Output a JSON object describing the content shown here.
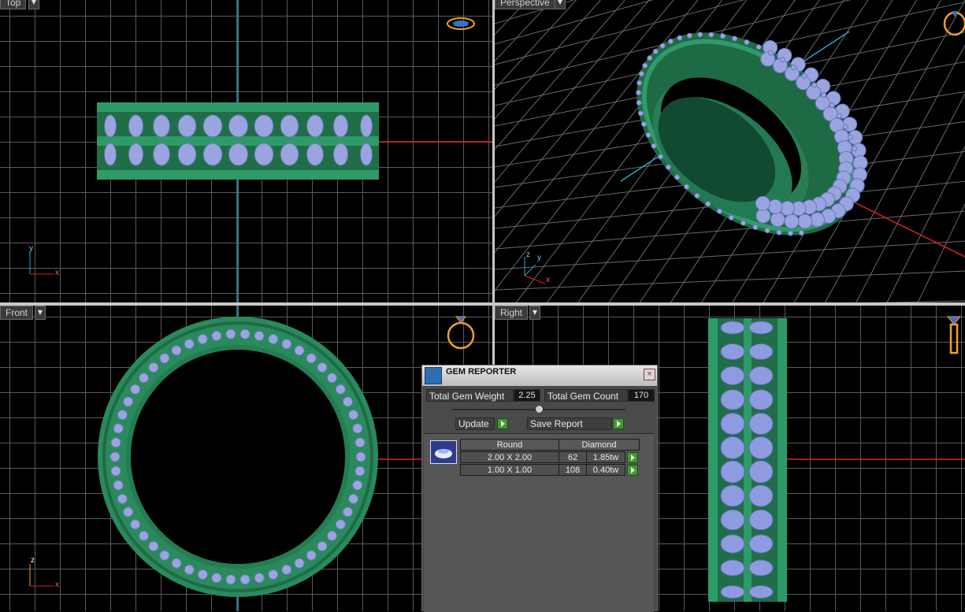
{
  "viewports": {
    "top": {
      "label": "Top"
    },
    "perspective": {
      "label": "Perspective"
    },
    "front": {
      "label": "Front"
    },
    "right": {
      "label": "Right"
    }
  },
  "axes": {
    "x": "x",
    "y": "y",
    "z": "z"
  },
  "colors": {
    "ring_green": "#2b8a5f",
    "gem_blue": "#9aa5e0",
    "grid_line": "#5a5a5a",
    "axis_red": "#e02020",
    "axis_cyan": "#2aa7c4",
    "ring_icon_gold": "#f0a020"
  },
  "gem_reporter": {
    "title": "GEM REPORTER",
    "close_icon": "close-icon",
    "total_weight_label": "Total Gem Weight",
    "total_weight_value": "2.25",
    "total_count_label": "Total Gem Count",
    "total_count_value": "170",
    "update_label": "Update",
    "save_report_label": "Save Report",
    "table": {
      "shape_header": "Round",
      "type_header": "Diamond",
      "rows": [
        {
          "size": "2.00 X 2.00",
          "count": "62",
          "weight": "1.85tw"
        },
        {
          "size": "1.00 X 1.00",
          "count": "108",
          "weight": "0.40tw"
        }
      ]
    }
  }
}
